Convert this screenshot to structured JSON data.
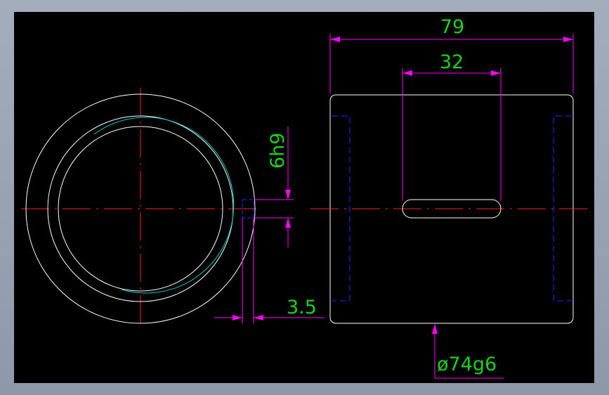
{
  "drawing": {
    "dimensions": {
      "overall_length": "79",
      "keyway_length": "32",
      "keyway_width": "6h9",
      "keyway_depth": "3.5",
      "outer_diameter": "ø74g6"
    },
    "colors": {
      "background": "#000000",
      "window_frame": "#9aa3b2",
      "outline": "#ffffff",
      "centerline": "#ff2020",
      "dimension_line": "#ff00ff",
      "dimension_text": "#19d219",
      "hidden_line": "#2424ff",
      "thread_arc": "#00c8c8"
    }
  }
}
